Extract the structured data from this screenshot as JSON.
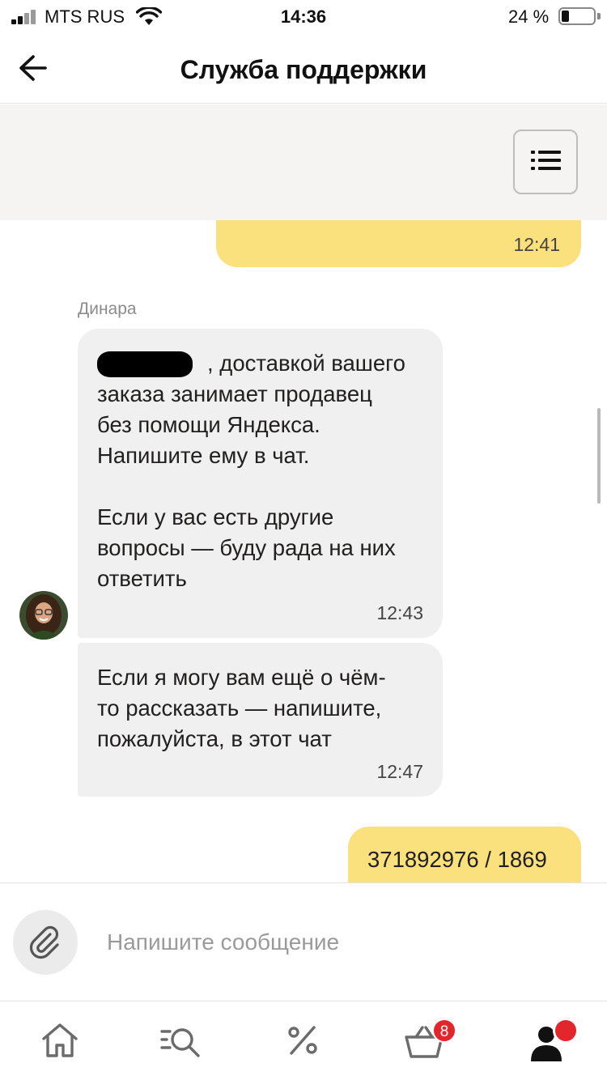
{
  "status_bar": {
    "carrier": "MTS RUS",
    "time": "14:36",
    "battery_percent_label": "24 %",
    "battery_level": 0.24
  },
  "header": {
    "title": "Служба поддержки",
    "back_icon": "arrow-left-icon"
  },
  "panel": {
    "menu_icon": "list-menu-icon"
  },
  "messages": [
    {
      "direction": "outgoing",
      "text": "",
      "time": "12:41"
    },
    {
      "direction": "incoming",
      "sender": "Динара",
      "text": ", доставкой вашего\nзаказа занимает продавец\nбез помощи Яндекса.\nНапишите ему в чат.\n\nЕсли у вас есть другие\nвопросы — буду рада на них\nответить",
      "time": "12:43"
    },
    {
      "direction": "incoming",
      "text": "Если я могу вам ещё о чём-\nто рассказать — напишите,\nпожалуйста, в этот чат",
      "time": "12:47"
    },
    {
      "direction": "outgoing",
      "text": "371892976 / 1869"
    }
  ],
  "composer": {
    "placeholder": "Напишите сообщение",
    "attach_icon": "paperclip-icon"
  },
  "tabbar": {
    "tabs": [
      {
        "name": "home",
        "icon": "home-icon"
      },
      {
        "name": "catalog",
        "icon": "catalog-search-icon"
      },
      {
        "name": "discounts",
        "icon": "percent-icon"
      },
      {
        "name": "cart",
        "icon": "cart-icon",
        "badge": "8"
      },
      {
        "name": "profile",
        "icon": "profile-icon"
      }
    ]
  },
  "colors": {
    "outgoing_bubble": "#fae17d",
    "incoming_bubble": "#f0f0f0",
    "badge": "#e3262c"
  }
}
